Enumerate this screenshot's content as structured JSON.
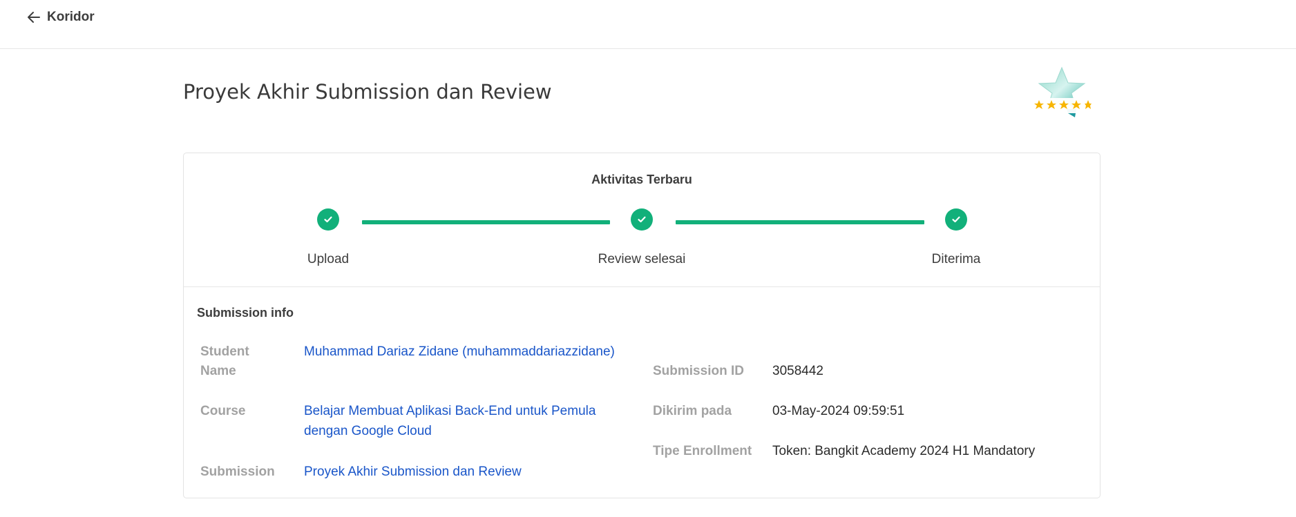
{
  "header": {
    "back_label": "Koridor"
  },
  "page": {
    "title": "Proyek Akhir Submission dan Review",
    "badge_icon": "five-star-rating-badge-icon"
  },
  "activity": {
    "title": "Aktivitas Terbaru",
    "steps": [
      {
        "label": "Upload",
        "status": "done"
      },
      {
        "label": "Review selesai",
        "status": "done"
      },
      {
        "label": "Diterima",
        "status": "done"
      }
    ]
  },
  "submission_info": {
    "title": "Submission info",
    "student_name_label": "Student Name",
    "student_name_value": "Muhammad Dariaz Zidane (muhammaddariazzidane)",
    "course_label": "Course",
    "course_value": "Belajar Membuat Aplikasi Back-End untuk Pemula dengan Google Cloud",
    "submission_label": "Submission",
    "submission_value": "Proyek Akhir Submission dan Review",
    "submission_id_label": "Submission ID",
    "submission_id_value": "3058442",
    "sent_at_label": "Dikirim pada",
    "sent_at_value": "03-May-2024 09:59:51",
    "enrollment_type_label": "Tipe Enrollment",
    "enrollment_type_value": "Token: Bangkit Academy 2024 H1 Mandatory"
  },
  "colors": {
    "accent_green": "#12b07a",
    "link_blue": "#1a56c9",
    "label_gray": "#a2a2a2",
    "star_yellow": "#f7b500"
  }
}
